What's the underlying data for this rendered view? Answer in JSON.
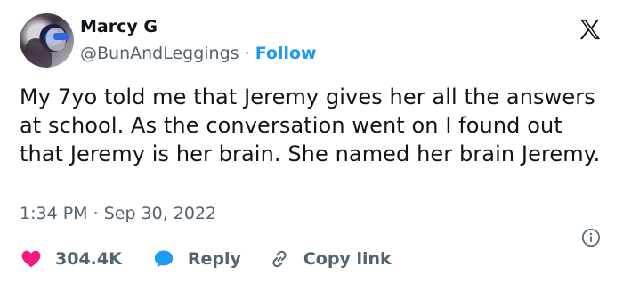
{
  "author": {
    "display_name": "Marcy G",
    "handle": "@BunAndLeggings",
    "separator": " · ",
    "follow_label": "Follow"
  },
  "tweet": {
    "text": "My 7yo told me that Jeremy gives her all the answers at school. As the conversation went on I found out that Jeremy is her brain. She named her brain Jeremy.",
    "time": "1:34 PM",
    "date_separator": " · ",
    "date": "Sep 30, 2022"
  },
  "actions": {
    "likes": "304.4K",
    "reply_label": "Reply",
    "copy_link_label": "Copy link"
  },
  "icons": {
    "like": "heart-icon",
    "reply": "speech-bubble-icon",
    "copy": "link-icon",
    "info": "info-icon",
    "brand": "x-logo-icon"
  },
  "colors": {
    "like": "#f91880",
    "reply": "#1d9bf0",
    "follow": "#1d9bf0",
    "muted": "#536471",
    "text": "#0f1419"
  }
}
